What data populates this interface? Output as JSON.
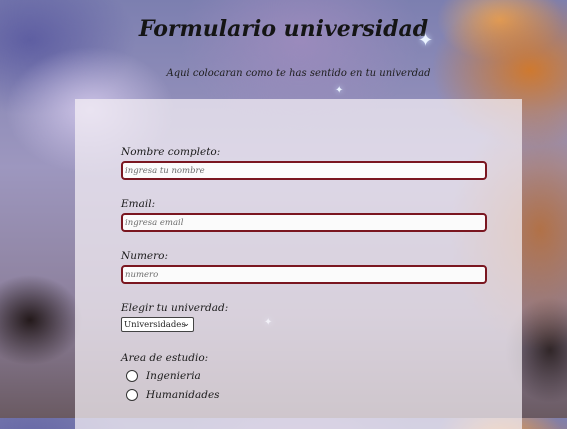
{
  "header": {
    "title": "Formulario universidad",
    "subtitle": "Aqui colocaran como te has sentido en tu univerdad"
  },
  "form": {
    "name_label": "Nombre completo:",
    "name_placeholder": "ingresa tu nombre",
    "email_label": "Email:",
    "email_placeholder": "ingresa email",
    "number_label": "Numero:",
    "number_placeholder": "numero",
    "university_label": "Elegir tu univerdad:",
    "university_selected": "Universidades",
    "area_label": "Area de estudio:",
    "areas": [
      "Ingenieria",
      "Humanidades"
    ]
  },
  "colors": {
    "field_border": "#7a1620",
    "panel": "#f5f0f5"
  },
  "icons": [
    "sparkle-icon",
    "chevron-down-icon",
    "radio-icon"
  ]
}
